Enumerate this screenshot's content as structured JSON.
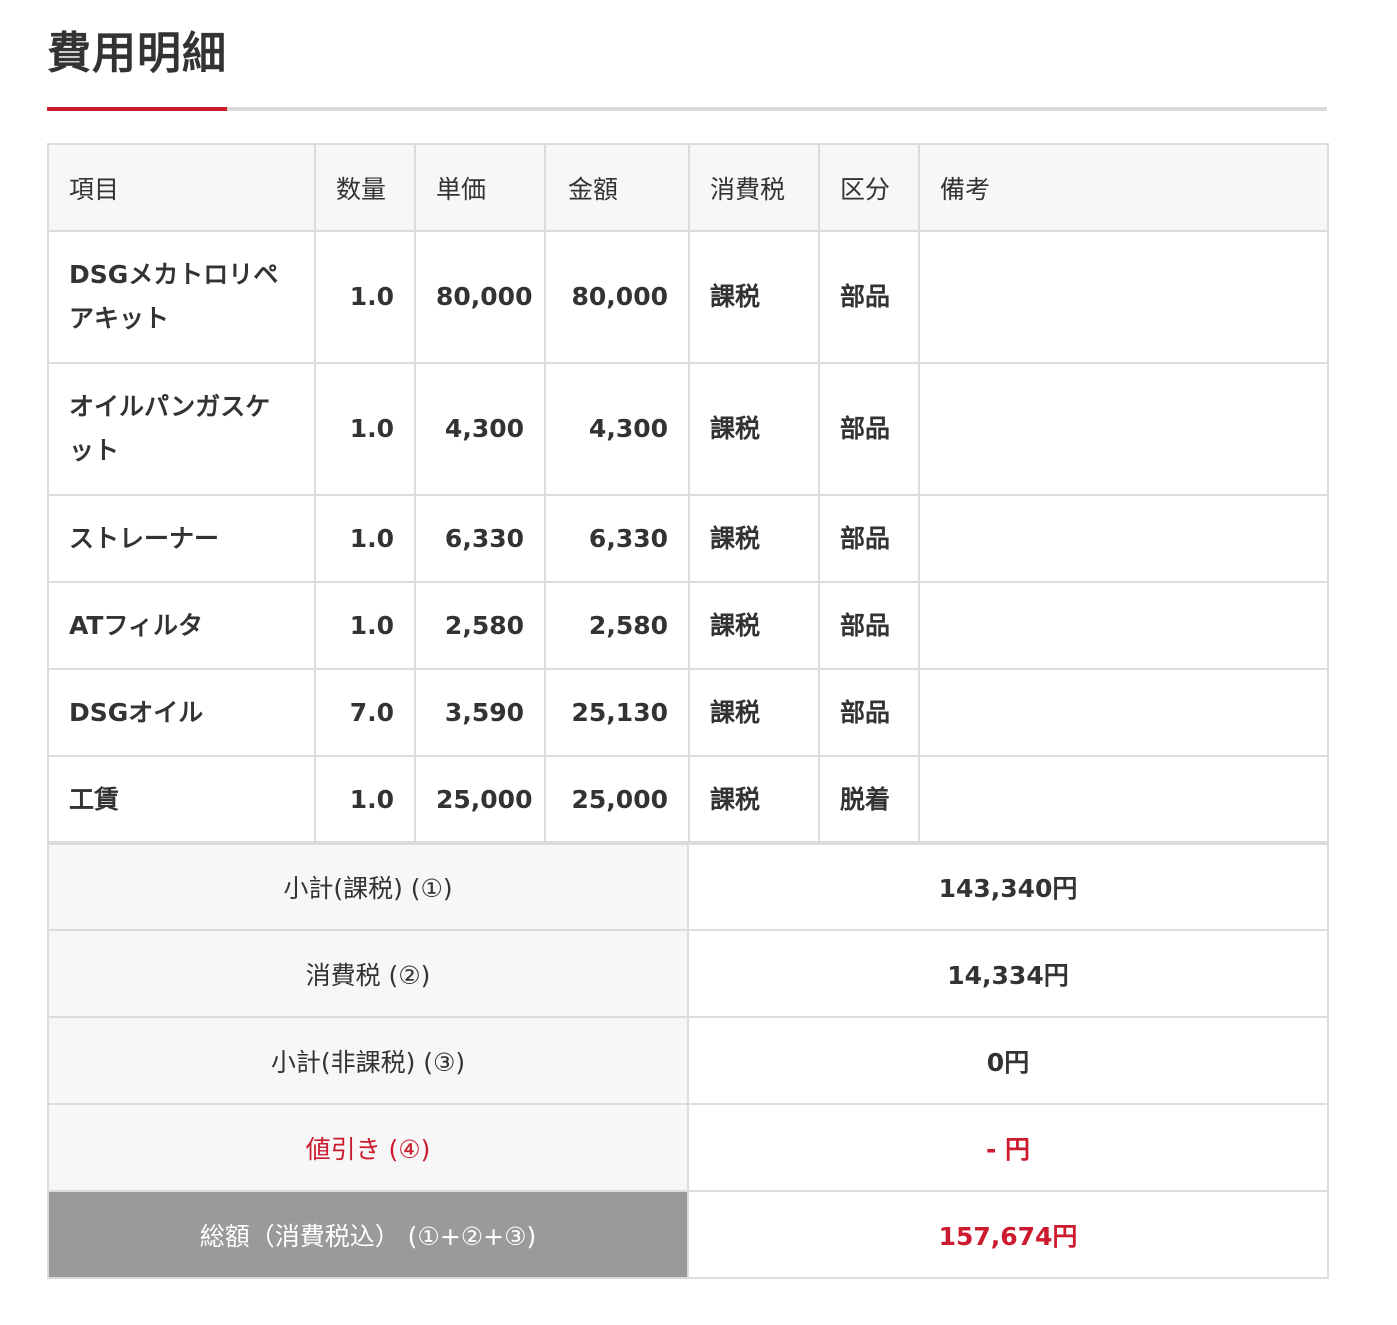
{
  "title": "費用明細",
  "colors": {
    "accent": "#cc1a2e",
    "header_bg": "#f7f7f7",
    "border": "#dcdcdc",
    "grand_label_bg": "#9a9a9a"
  },
  "table": {
    "headers": {
      "item": "項目",
      "quantity": "数量",
      "unit_price": "単価",
      "amount": "金額",
      "tax": "消費税",
      "category": "区分",
      "notes": "備考"
    },
    "rows": [
      {
        "item": "DSGメカトロリペアキット",
        "quantity": "1.0",
        "unit_price": "80,000",
        "amount": "80,000",
        "tax": "課税",
        "category": "部品",
        "notes": ""
      },
      {
        "item": "オイルパンガスケット",
        "quantity": "1.0",
        "unit_price": "4,300",
        "amount": "4,300",
        "tax": "課税",
        "category": "部品",
        "notes": ""
      },
      {
        "item": "ストレーナー",
        "quantity": "1.0",
        "unit_price": "6,330",
        "amount": "6,330",
        "tax": "課税",
        "category": "部品",
        "notes": ""
      },
      {
        "item": "ATフィルタ",
        "quantity": "1.0",
        "unit_price": "2,580",
        "amount": "2,580",
        "tax": "課税",
        "category": "部品",
        "notes": ""
      },
      {
        "item": "DSGオイル",
        "quantity": "7.0",
        "unit_price": "3,590",
        "amount": "25,130",
        "tax": "課税",
        "category": "部品",
        "notes": ""
      },
      {
        "item": "工賃",
        "quantity": "1.0",
        "unit_price": "25,000",
        "amount": "25,000",
        "tax": "課税",
        "category": "脱着",
        "notes": ""
      }
    ]
  },
  "totals": {
    "subtotal_taxable": {
      "label": "小計(課税) (①)",
      "value": "143,340円"
    },
    "consumption_tax": {
      "label": "消費税 (②)",
      "value": "14,334円"
    },
    "subtotal_nontaxable": {
      "label": "小計(非課税) (③)",
      "value": "0円"
    },
    "discount": {
      "label": "値引き (④)",
      "value": "- 円"
    },
    "grand_total": {
      "label": "総額（消費税込） (①+②+③)",
      "value": "157,674円"
    }
  }
}
